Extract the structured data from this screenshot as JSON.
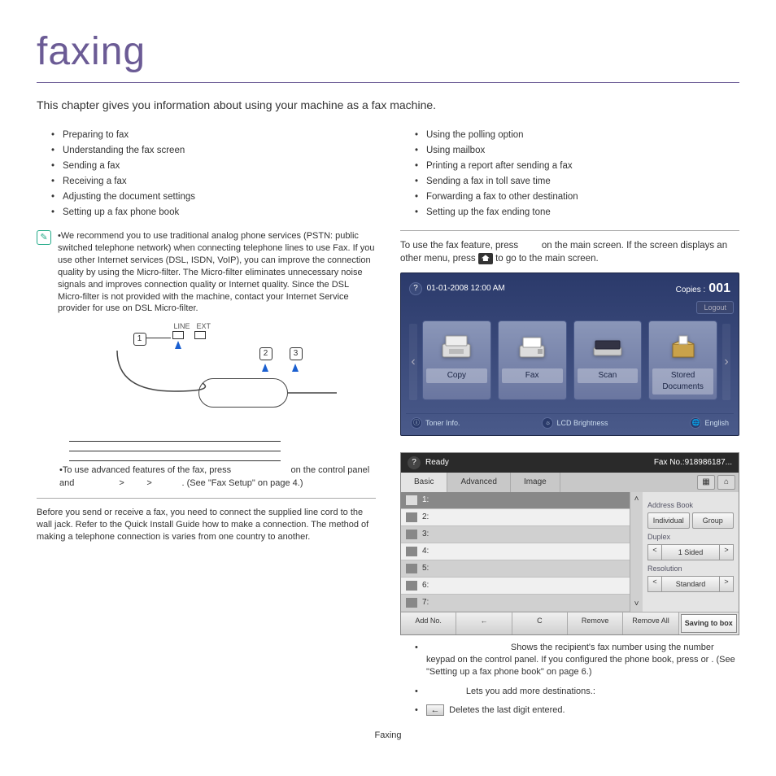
{
  "page": {
    "title": "faxing",
    "intro": "This chapter gives you information about using your machine as a fax machine.",
    "footer": "Faxing"
  },
  "topics_left": [
    "Preparing to fax",
    "Understanding the fax screen",
    "Sending a fax",
    "Receiving a fax",
    "Adjusting the document settings",
    "Setting up a fax phone book"
  ],
  "topics_right": [
    "Using the polling option",
    "Using mailbox",
    "Printing a report after sending a fax",
    "Sending a fax in toll save time",
    "Forwarding a fax to other destination",
    "Setting up the fax ending tone"
  ],
  "note1": "We recommend you to use traditional analog phone services (PSTN: public switched telephone network) when connecting telephone lines to use Fax. If you use other Internet services (DSL, ISDN, VoIP), you can improve the connection quality by using the Micro-filter. The Micro-filter eliminates unnecessary noise signals and improves connection quality or Internet quality. Since the DSL Micro-filter is not provided with the machine, contact your Internet Service provider for use on DSL Micro-filter.",
  "diagram": {
    "line": "LINE",
    "ext": "EXT",
    "n1": "1",
    "n2": "2",
    "n3": "3"
  },
  "note2a": "To use advanced features of the fax, press",
  "note2b": "on the control panel and",
  "note2c": ">",
  "note2d": ">",
  "note2e": ". (See \"Fax Setup\" on page 4.)",
  "prep": "Before you send or receive a fax, you need to connect the supplied line cord to the wall jack. Refer to the Quick Install Guide how to make a connection. The method of making a telephone connection is varies from one country to another.",
  "intro2a": "To use the fax feature, press",
  "intro2b": "on the main screen. If the screen displays an other menu, press",
  "intro2c": "to go to the main screen.",
  "screen1": {
    "datetime": "01-01-2008 12:00 AM",
    "copies_label": "Copies :",
    "copies_value": "001",
    "logout": "Logout",
    "tiles": [
      "Copy",
      "Fax",
      "Scan",
      "Stored Documents"
    ],
    "bottom": [
      "Toner Info.",
      "LCD Brightness",
      "English"
    ]
  },
  "screen2": {
    "status": "Ready",
    "faxno_label": "Fax No.:",
    "faxno": "918986187...",
    "tabs": [
      "Basic",
      "Advanced",
      "Image"
    ],
    "rows": [
      "1:",
      "2:",
      "3:",
      "4:",
      "5:",
      "6:",
      "7:"
    ],
    "side": {
      "addrbook": "Address Book",
      "individual": "Individual",
      "group": "Group",
      "duplex": "Duplex",
      "duplex_val": "1 Sided",
      "resolution": "Resolution",
      "resolution_val": "Standard"
    },
    "footer": {
      "addno": "Add No.",
      "back": "←",
      "c": "C",
      "remove": "Remove",
      "removeall": "Remove All",
      "save": "Saving to box"
    }
  },
  "desc": {
    "d1": "Shows the recipient's fax number using the number keypad on the control panel. If you configured the phone book, press                or          . (See \"Setting up a fax phone book\" on page 6.)",
    "d2": "Lets you add more destinations.:",
    "d3": "Deletes the last digit entered."
  }
}
